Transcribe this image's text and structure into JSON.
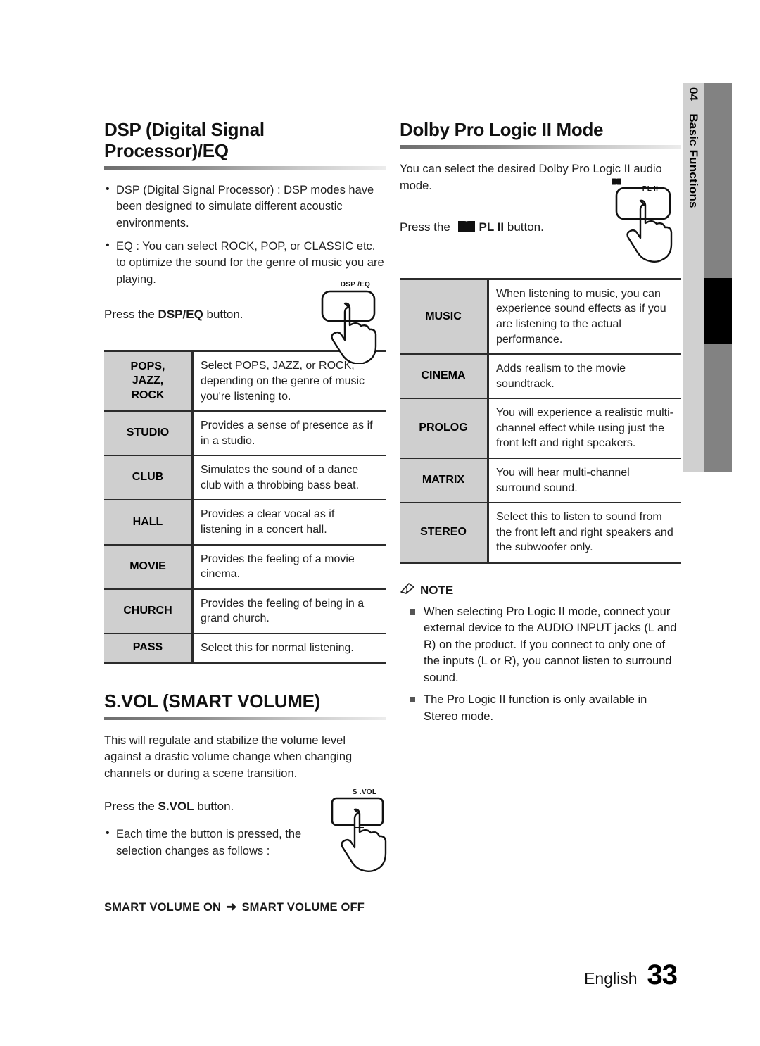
{
  "sidebar": {
    "chapter_number": "04",
    "chapter_title": "Basic Functions"
  },
  "footer": {
    "language": "English",
    "page_number": "33"
  },
  "left_column": {
    "dsp": {
      "heading": "DSP (Digital Signal Processor)/EQ",
      "bullets": [
        "DSP (Digital Signal Processor) : DSP modes have been designed to simulate different acoustic environments.",
        "EQ : You can select ROCK, POP, or CLASSIC etc. to optimize the sound for the genre of music you are playing."
      ],
      "press_prefix": "Press the ",
      "press_button": "DSP/EQ",
      "press_suffix": " button.",
      "button_illustration_label": "DSP /EQ",
      "table": [
        {
          "key_lines": [
            "POPS,",
            "JAZZ,",
            "ROCK"
          ],
          "desc": "Select POPS, JAZZ, or ROCK, depending on the genre of music you're listening to."
        },
        {
          "key_lines": [
            "STUDIO"
          ],
          "desc": "Provides a sense of presence as if in a studio."
        },
        {
          "key_lines": [
            "CLUB"
          ],
          "desc": "Simulates the sound of a dance club with a throbbing bass beat."
        },
        {
          "key_lines": [
            "HALL"
          ],
          "desc": "Provides a clear vocal as if listening in a concert hall."
        },
        {
          "key_lines": [
            "MOVIE"
          ],
          "desc": "Provides the feeling of a movie cinema."
        },
        {
          "key_lines": [
            "CHURCH"
          ],
          "desc": "Provides the feeling of being in a grand church."
        },
        {
          "key_lines": [
            "PASS"
          ],
          "desc": "Select this for normal listening."
        }
      ]
    },
    "svol": {
      "heading": "S.VOL (SMART VOLUME)",
      "paragraph": "This will regulate and stabilize the volume level against a drastic volume change when changing channels or during a scene transition.",
      "press_prefix": "Press the ",
      "press_button": "S.VOL",
      "press_suffix": " button.",
      "button_illustration_label": "S .VOL",
      "bullets": [
        "Each time the button is pressed, the selection changes as follows :"
      ],
      "flow_from": "SMART VOLUME ON",
      "flow_arrow": "➜",
      "flow_to": "SMART VOLUME OFF"
    }
  },
  "right_column": {
    "dolby": {
      "heading": "Dolby Pro Logic II Mode",
      "paragraph": "You can select the desired Dolby Pro Logic II audio mode.",
      "press_prefix": "Press the ",
      "press_button": "PL II",
      "press_suffix": " button.",
      "button_illustration_label": "PL II",
      "table": [
        {
          "key_lines": [
            "MUSIC"
          ],
          "desc": "When listening to music, you can experience sound effects as if you are listening to the actual performance."
        },
        {
          "key_lines": [
            "CINEMA"
          ],
          "desc": "Adds realism to the movie soundtrack."
        },
        {
          "key_lines": [
            "PROLOG"
          ],
          "desc": "You will experience a realistic multi-channel effect while using just the front left and right speakers."
        },
        {
          "key_lines": [
            "MATRIX"
          ],
          "desc": "You will hear multi-channel surround sound."
        },
        {
          "key_lines": [
            "STEREO"
          ],
          "desc": "Select this to listen to sound from the front left and right speakers and the subwoofer only."
        }
      ]
    },
    "note": {
      "title": "NOTE",
      "items": [
        "When selecting Pro Logic II mode, connect your external device to the AUDIO INPUT jacks (L and R) on the product. If you connect to only one of the inputs (L or R), you cannot listen to surround sound.",
        "The Pro Logic II function is only available in Stereo mode."
      ]
    }
  },
  "colors": {
    "table_key_bg": "#cfcfcf",
    "rule_dark": "#6d6d6d",
    "tab_light": "#d0d0d0",
    "tab_dark": "#828282",
    "tab_marker": "#000000"
  }
}
